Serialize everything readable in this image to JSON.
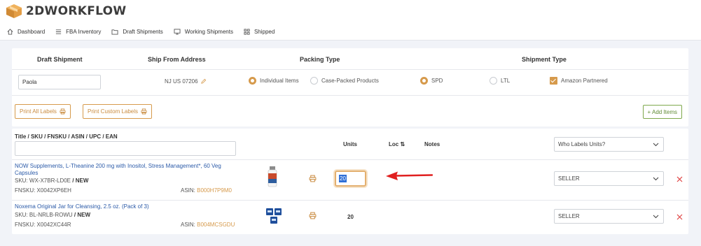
{
  "app": {
    "brand": "2DWORKFLOW"
  },
  "nav": [
    {
      "label": "Dashboard",
      "icon": "home-icon"
    },
    {
      "label": "FBA Inventory",
      "icon": "list-icon"
    },
    {
      "label": "Draft Shipments",
      "icon": "folder-icon"
    },
    {
      "label": "Working Shipments",
      "icon": "monitor-icon"
    },
    {
      "label": "Shipped",
      "icon": "grid-icon"
    }
  ],
  "shipment": {
    "headers": {
      "draft": "Draft Shipment",
      "from": "Ship From Address",
      "packing": "Packing Type",
      "type": "Shipment Type"
    },
    "draft_name": "Paola",
    "ship_from": "NJ US 07206",
    "packing_options": {
      "individual": "Individual Items",
      "case": "Case-Packed Products"
    },
    "packing_selected": "individual",
    "type_options": {
      "spd": "SPD",
      "ltl": "LTL"
    },
    "type_selected": "spd",
    "amazon_partnered": {
      "label": "Amazon Partnered",
      "checked": true
    },
    "buttons": {
      "print_all": "Print All Labels",
      "print_custom": "Print Custom Labels",
      "add_items": "+ Add Items"
    }
  },
  "items_table": {
    "columns": {
      "title": "Title / SKU / FNSKU / ASIN / UPC / EAN",
      "units": "Units",
      "loc": "Loc ⇅",
      "notes": "Notes"
    },
    "who_labels": "Who Labels Units?",
    "search_value": "",
    "rows": [
      {
        "title": "NOW Supplements, L-Theanine 200 mg with Inositol, Stress Management*, 60 Veg Capsules",
        "sku_label": "SKU: WX-X7BR-LD0E",
        "condition": " / NEW",
        "fnsku": "FNSKU: X0042XP6EH",
        "asin_label": "ASIN: ",
        "asin": "B000H7P9M0",
        "units": "20",
        "labeler": "SELLER"
      },
      {
        "title": "Noxema Original Jar for Cleansing, 2.5 oz. (Pack of 3)",
        "sku_label": "SKU: BL-NRLB-ROWU",
        "condition": " / NEW",
        "fnsku": "FNSKU: X0042XC44R",
        "asin_label": "ASIN: ",
        "asin": "B004MCSGDU",
        "units": "20",
        "labeler": "SELLER"
      }
    ]
  },
  "colors": {
    "accent": "#d69a4c",
    "link": "#2b5aa8",
    "green": "#7ea84c",
    "danger": "#e04545",
    "arrow": "#e02020"
  }
}
